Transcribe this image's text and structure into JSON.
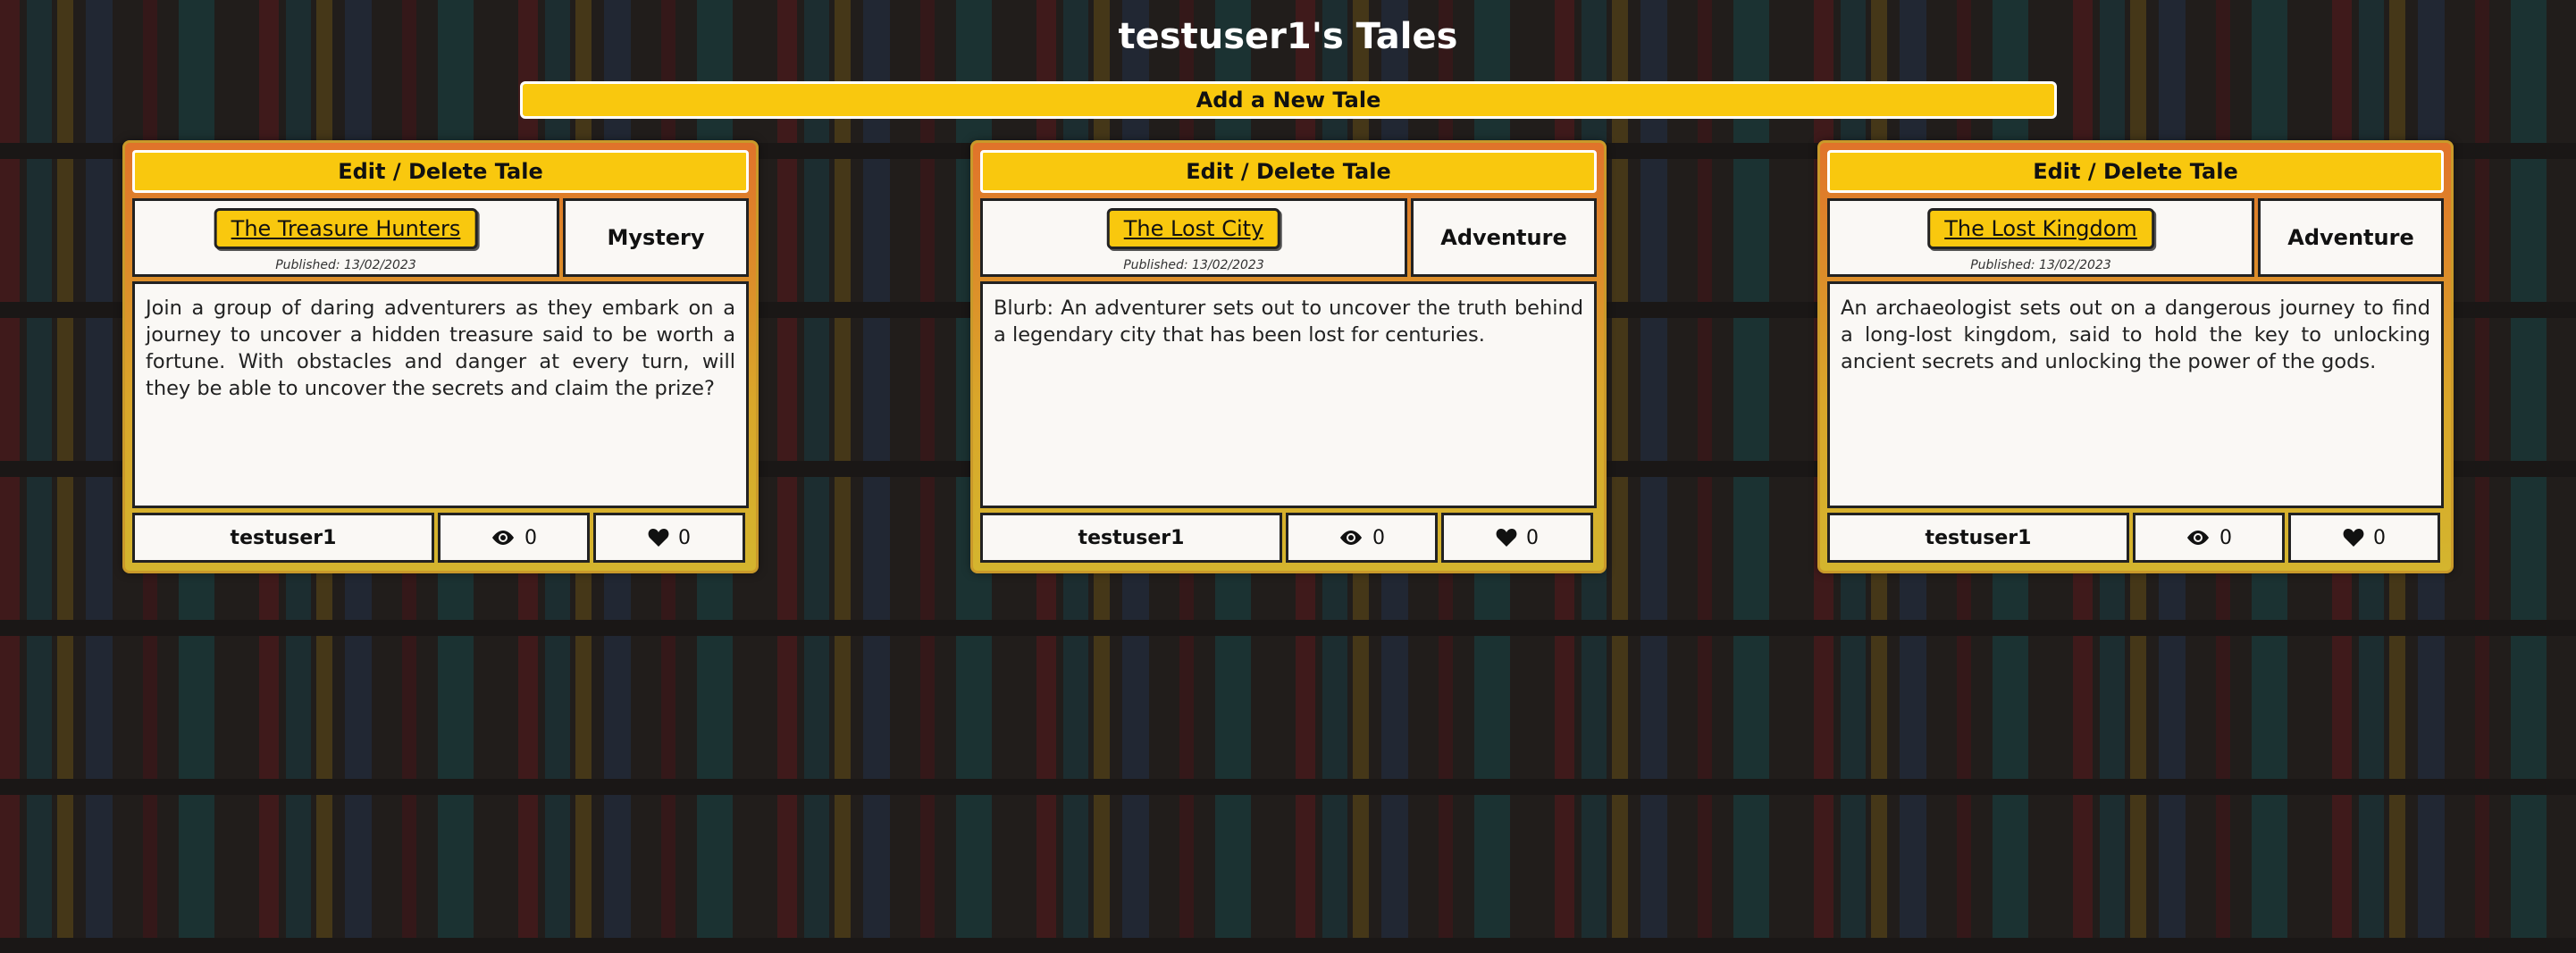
{
  "header": {
    "title": "testuser1's Tales",
    "add_button_label": "Add a New Tale"
  },
  "tales": [
    {
      "edit_label": "Edit / Delete Tale",
      "title": "The Treasure Hunters",
      "published": "Published: 13/02/2023",
      "genre": "Mystery",
      "blurb": "Join a group of daring adventurers as they embark on a journey to uncover a hidden treasure said to be worth a fortune. With obstacles and danger at every turn, will they be able to uncover the secrets and claim the prize?",
      "author": "testuser1",
      "views": "0",
      "likes": "0"
    },
    {
      "edit_label": "Edit / Delete Tale",
      "title": "The Lost City",
      "published": "Published: 13/02/2023",
      "genre": "Adventure",
      "blurb": "Blurb: An adventurer sets out to uncover the truth behind a legendary city that has been lost for centuries.",
      "author": "testuser1",
      "views": "0",
      "likes": "0"
    },
    {
      "edit_label": "Edit / Delete Tale",
      "title": "The Lost Kingdom",
      "published": "Published: 13/02/2023",
      "genre": "Adventure",
      "blurb": "An archaeologist sets out on a dangerous journey to find a long-lost kingdom, said to hold the key to unlocking ancient secrets and unlocking the power of the gods.",
      "author": "testuser1",
      "views": "0",
      "likes": "0"
    }
  ],
  "icons": {
    "views": "eye-icon",
    "likes": "heart-icon"
  },
  "colors": {
    "accent": "#f9c80e",
    "card_border": "#c9992a",
    "panel": "#faf8f5"
  }
}
